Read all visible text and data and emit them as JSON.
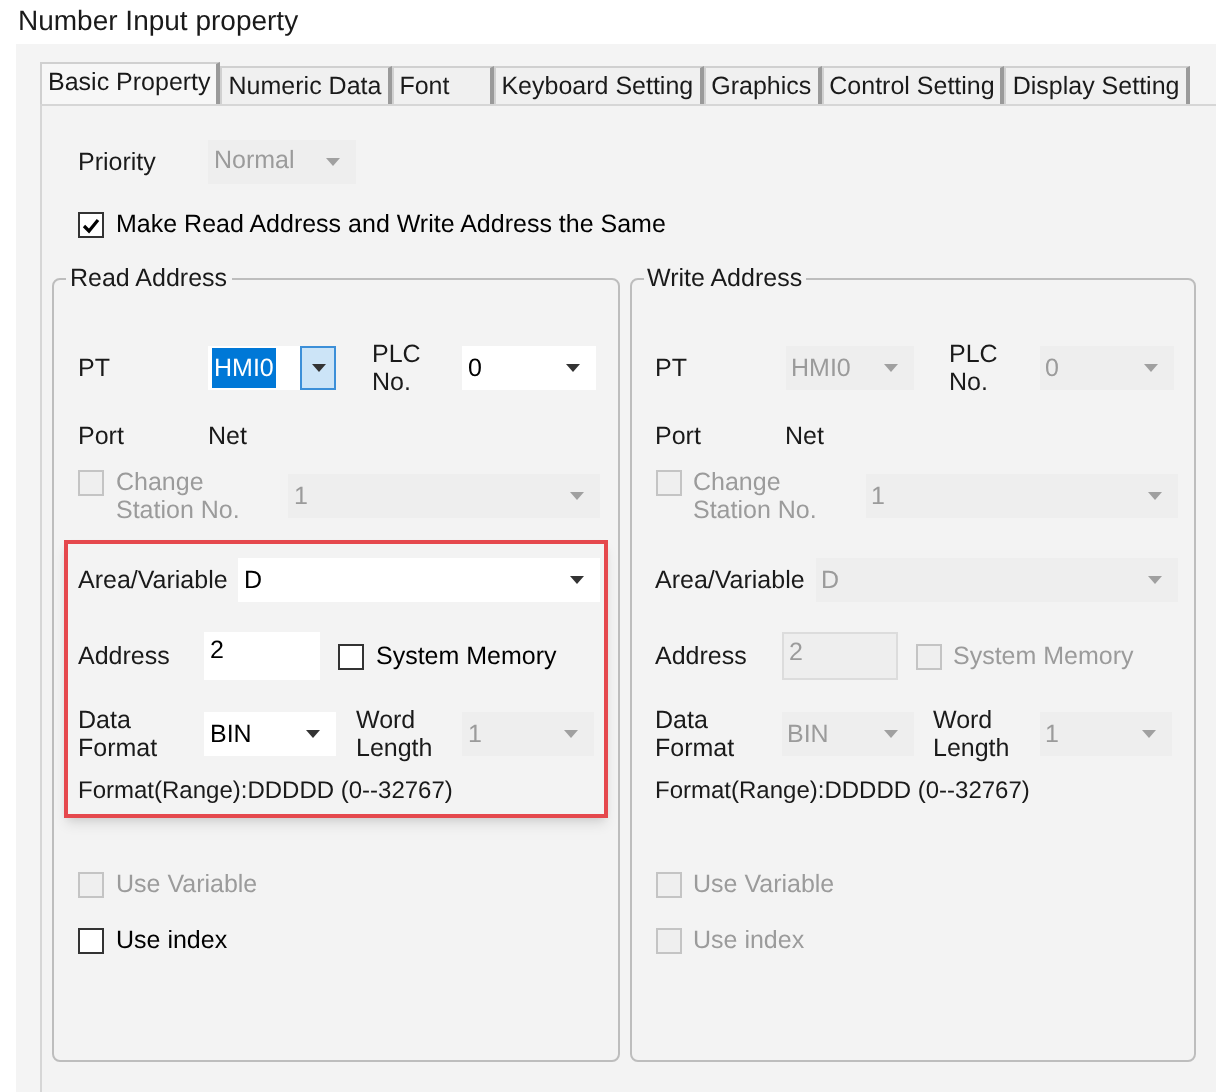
{
  "window": {
    "title": "Number Input property"
  },
  "tabs": [
    {
      "label": "Basic Property",
      "selected": true
    },
    {
      "label": "Numeric Data",
      "selected": false
    },
    {
      "label": "Font",
      "selected": false
    },
    {
      "label": "Keyboard Setting",
      "selected": false
    },
    {
      "label": "Graphics",
      "selected": false
    },
    {
      "label": "Control Setting",
      "selected": false
    },
    {
      "label": "Display Setting",
      "selected": false
    }
  ],
  "priority": {
    "label": "Priority",
    "value": "Normal",
    "disabled": true
  },
  "same_address": {
    "label": "Make Read Address and Write Address the Same",
    "checked": true
  },
  "panels": [
    {
      "title": "Read Address",
      "highlight": true,
      "pt": {
        "label": "PT",
        "value": "HMI0",
        "disabled": false,
        "focused": true
      },
      "plc": {
        "label": "PLC No.",
        "value": "0",
        "disabled": false
      },
      "port": {
        "label": "Port",
        "value": "Net"
      },
      "change_station": {
        "label": "Change Station No.",
        "checked": false,
        "disabled": true,
        "value": "1"
      },
      "area": {
        "label": "Area/Variable",
        "value": "D",
        "disabled": false
      },
      "address": {
        "label": "Address",
        "value": "2",
        "disabled": false
      },
      "system_memory": {
        "label": "System Memory",
        "checked": false,
        "disabled": false
      },
      "data_format": {
        "label": "Data Format",
        "value": "BIN",
        "disabled": false
      },
      "word_length": {
        "label": "Word Length",
        "value": "1",
        "disabled": true
      },
      "format_range": "Format(Range):DDDDD (0--32767)",
      "use_variable": {
        "label": "Use Variable",
        "checked": false,
        "disabled": true
      },
      "use_index": {
        "label": "Use index",
        "checked": false,
        "disabled": false
      }
    },
    {
      "title": "Write Address",
      "highlight": false,
      "pt": {
        "label": "PT",
        "value": "HMI0",
        "disabled": true,
        "focused": false
      },
      "plc": {
        "label": "PLC No.",
        "value": "0",
        "disabled": true
      },
      "port": {
        "label": "Port",
        "value": "Net"
      },
      "change_station": {
        "label": "Change Station No.",
        "checked": false,
        "disabled": true,
        "value": "1"
      },
      "area": {
        "label": "Area/Variable",
        "value": "D",
        "disabled": true
      },
      "address": {
        "label": "Address",
        "value": "2",
        "disabled": true
      },
      "system_memory": {
        "label": "System Memory",
        "checked": false,
        "disabled": true
      },
      "data_format": {
        "label": "Data Format",
        "value": "BIN",
        "disabled": true
      },
      "word_length": {
        "label": "Word Length",
        "value": "1",
        "disabled": true
      },
      "format_range": "Format(Range):DDDDD (0--32767)",
      "use_variable": {
        "label": "Use Variable",
        "checked": false,
        "disabled": true
      },
      "use_index": {
        "label": "Use index",
        "checked": false,
        "disabled": true
      }
    }
  ]
}
